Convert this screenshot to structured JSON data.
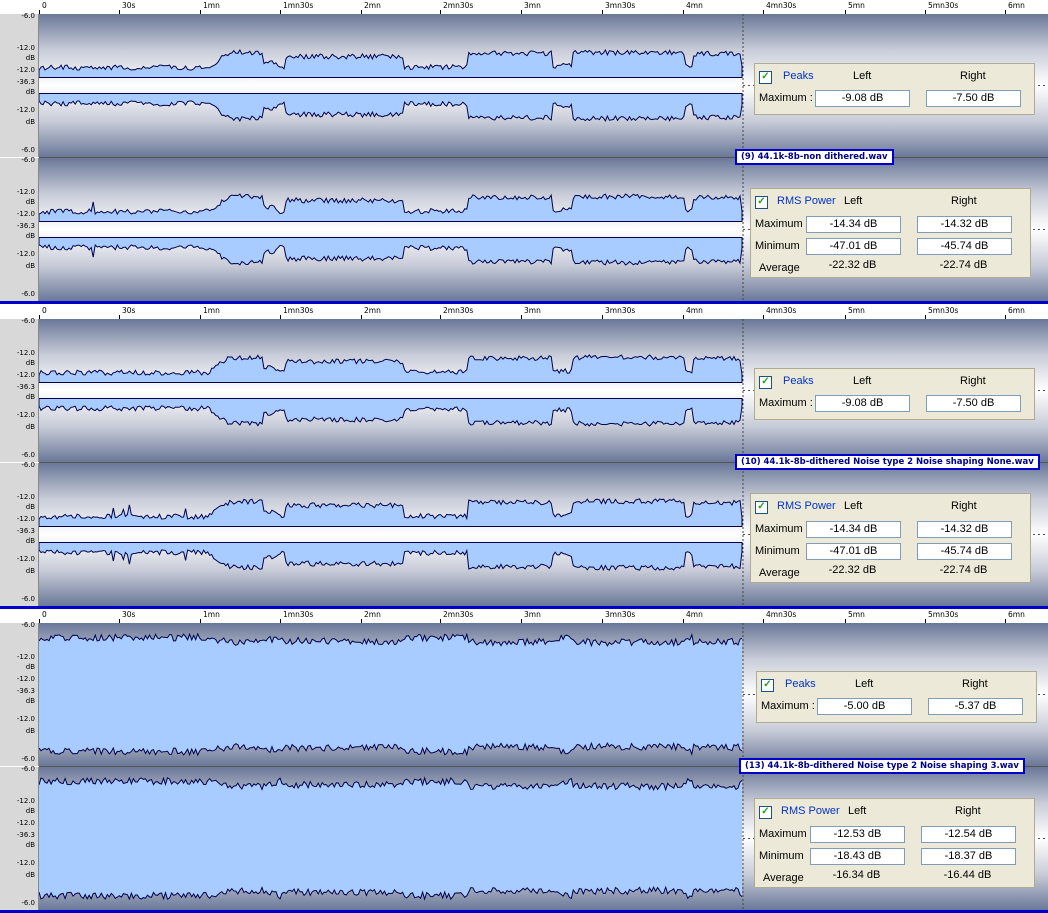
{
  "ruler": {
    "ticks": [
      "0",
      "30s",
      "1mn",
      "1mn30s",
      "2mn",
      "2mn30s",
      "3mn",
      "3mn30s",
      "4mn",
      "4mn30s",
      "5mn",
      "5mn30s",
      "6mn"
    ]
  },
  "yaxis_labels": [
    "-6.0",
    "-12.0",
    "dB",
    "-12.0",
    "-36.3",
    "dB",
    "-12.0",
    "dB",
    "-6.0"
  ],
  "colors": {
    "wave_fill": "#a8ccff",
    "wave_edge": "#00004a",
    "accent": "#0000cc",
    "box_bg": "#ece9d8"
  },
  "panels": [
    {
      "file_title": "(9) 44.1k-8b-non dithered.wav",
      "peaks": {
        "title": "Peaks",
        "left_hdr": "Left",
        "right_hdr": "Right",
        "max_label": "Maximum :",
        "max_left": "-9.08 dB",
        "max_right": "-7.50 dB"
      },
      "rms": {
        "title": "RMS Power",
        "left_hdr": "Left",
        "right_hdr": "Right",
        "max_label": "Maximum",
        "max_left": "-14.34 dB",
        "max_right": "-14.32 dB",
        "min_label": "Minimum",
        "min_left": "-47.01 dB",
        "min_right": "-45.74 dB",
        "avg_label": "Average",
        "avg_left": "-22.32 dB",
        "avg_right": "-22.74 dB"
      }
    },
    {
      "file_title": "(10) 44.1k-8b-dithered Noise type 2 Noise shaping None.wav",
      "peaks": {
        "title": "Peaks",
        "left_hdr": "Left",
        "right_hdr": "Right",
        "max_label": "Maximum :",
        "max_left": "-9.08 dB",
        "max_right": "-7.50 dB"
      },
      "rms": {
        "title": "RMS Power",
        "left_hdr": "Left",
        "right_hdr": "Right",
        "max_label": "Maximum",
        "max_left": "-14.34 dB",
        "max_right": "-14.32 dB",
        "min_label": "Minimum",
        "min_left": "-47.01 dB",
        "min_right": "-45.74 dB",
        "avg_label": "Average",
        "avg_left": "-22.32 dB",
        "avg_right": "-22.74 dB"
      }
    },
    {
      "file_title": "(13) 44.1k-8b-dithered Noise type 2 Noise shaping 3.wav",
      "peaks": {
        "title": "Peaks",
        "left_hdr": "Left",
        "right_hdr": "Right",
        "max_label": "Maximum :",
        "max_left": "-5.00 dB",
        "max_right": "-5.37 dB"
      },
      "rms": {
        "title": "RMS Power",
        "left_hdr": "Left",
        "right_hdr": "Right",
        "max_label": "Maximum",
        "max_left": "-12.53 dB",
        "max_right": "-12.54 dB",
        "min_label": "Minimum",
        "min_left": "-18.43 dB",
        "min_right": "-18.37 dB",
        "avg_label": "Average",
        "avg_left": "-16.34 dB",
        "avg_right": "-16.44 dB"
      }
    }
  ]
}
